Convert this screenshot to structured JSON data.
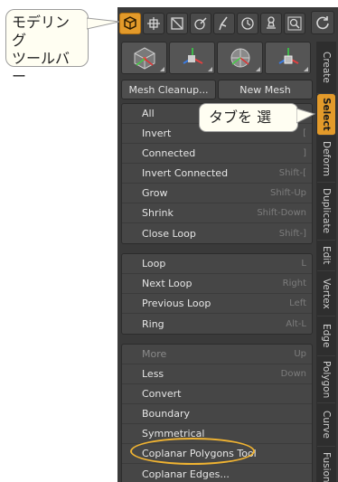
{
  "toolbar": {
    "callout_line1": "モデリング",
    "callout_line2": "ツールバー",
    "buttons": [
      "cube-icon",
      "grid-move-icon",
      "select-area-icon",
      "pen-edit-icon",
      "sculpt-icon",
      "clock-icon",
      "stamp-icon",
      "magnify-icon"
    ],
    "refresh_icon": "refresh-icon"
  },
  "tab_callout": {
    "text": "タブを 選"
  },
  "panel": {
    "buttons": {
      "mesh_cleanup": "Mesh Cleanup...",
      "new_mesh": "New Mesh"
    },
    "group1": [
      {
        "label": "All",
        "key": ""
      },
      {
        "label": "Invert",
        "key": "["
      },
      {
        "label": "Connected",
        "key": "]"
      },
      {
        "label": "Invert Connected",
        "key": "Shift-["
      },
      {
        "label": "Grow",
        "key": "Shift-Up"
      },
      {
        "label": "Shrink",
        "key": "Shift-Down"
      },
      {
        "label": "Close Loop",
        "key": "Shift-]"
      }
    ],
    "group2": [
      {
        "label": "Loop",
        "key": "L"
      },
      {
        "label": "Next Loop",
        "key": "Right"
      },
      {
        "label": "Previous Loop",
        "key": "Left"
      },
      {
        "label": "Ring",
        "key": "Alt-L"
      }
    ],
    "group3": [
      {
        "label": "More",
        "key": "Up"
      },
      {
        "label": "Less",
        "key": "Down"
      },
      {
        "label": "Convert",
        "key": ""
      },
      {
        "label": "Boundary",
        "key": ""
      },
      {
        "label": "Symmetrical",
        "key": ""
      },
      {
        "label": "Coplanar Polygons Tool",
        "key": ""
      },
      {
        "label": "Coplanar Edges...",
        "key": ""
      }
    ]
  },
  "tabs": [
    "Create",
    "Select",
    "Deform",
    "Duplicate",
    "Edit",
    "Vertex",
    "Edge",
    "Polygon",
    "Curve",
    "Fusion"
  ],
  "active_tab": "Select",
  "colors": {
    "accent": "#e39a2a",
    "highlight_ellipse": "#f0b331"
  }
}
